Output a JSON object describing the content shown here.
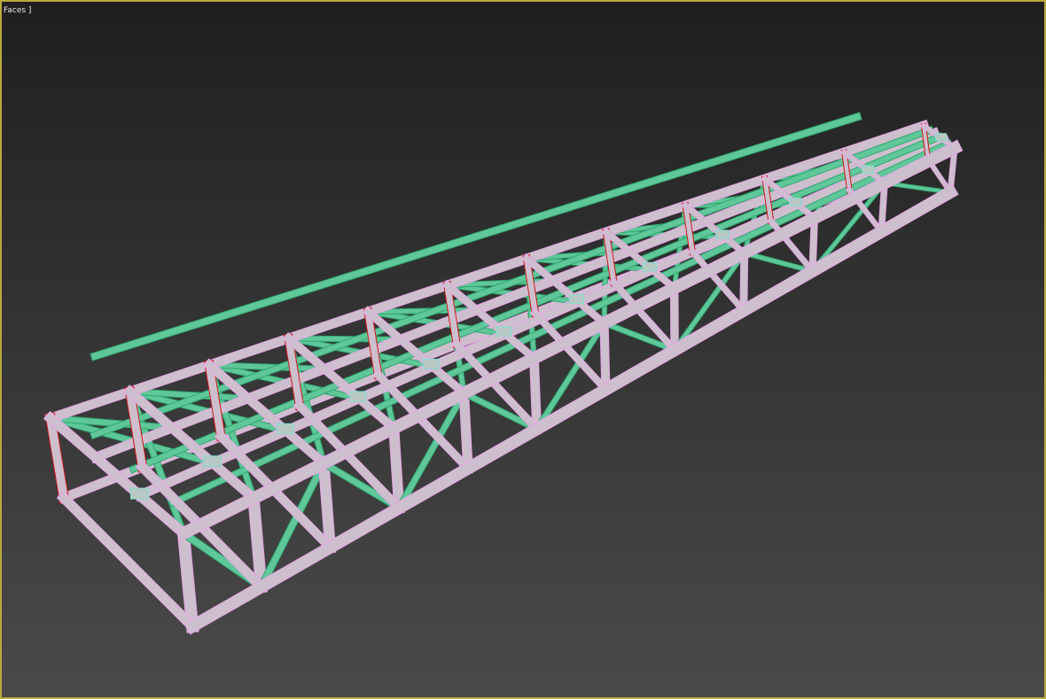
{
  "viewport": {
    "label": "Faces ]",
    "border_color": "#b9a93a",
    "colors": {
      "frame": "#cdbfcd",
      "frame_edge": "#e6a6e6",
      "brace": "#5fc79a",
      "brace_edge": "#2fa86e",
      "column_edge": "#d01818"
    }
  }
}
